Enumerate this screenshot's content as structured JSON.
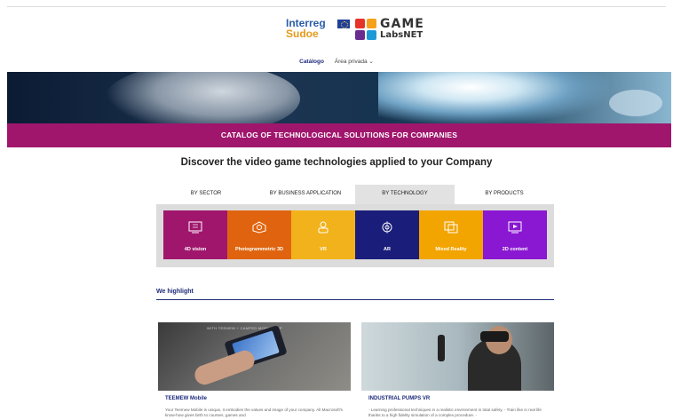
{
  "header": {
    "logo_interreg_line1": "Interreg",
    "logo_interreg_line2": "Sudoe",
    "logo_game_line1": "GAME",
    "logo_game_line2": "LabsNET"
  },
  "nav": {
    "catalog": "Catálogo",
    "private_area": "Área privada ⌄"
  },
  "banner": {
    "text": "CATALOG OF TECHNOLOGICAL SOLUTIONS FOR COMPANIES"
  },
  "heading": "Discover the video game technologies applied to your Company",
  "tabs": [
    {
      "label": "BY SECTOR",
      "active": false
    },
    {
      "label": "BY BUSINESS APPLICATION",
      "active": false
    },
    {
      "label": "BY TECHNOLOGY",
      "active": true
    },
    {
      "label": "BY PRODUCTS",
      "active": false
    }
  ],
  "tiles": [
    {
      "label": "4D vision",
      "color": "#a0166d",
      "icon": "4d-vision-icon"
    },
    {
      "label": "Photogrammetric 3D",
      "color": "#e0640f",
      "icon": "photogrammetry-icon"
    },
    {
      "label": "VR",
      "color": "#f2b21b",
      "icon": "vr-headset-icon"
    },
    {
      "label": "AR",
      "color": "#1a1d7a",
      "icon": "ar-icon"
    },
    {
      "label": "Mixed Reality",
      "color": "#f2a400",
      "icon": "mixed-reality-icon"
    },
    {
      "label": "2D content",
      "color": "#8a17d1",
      "icon": "2d-content-icon"
    }
  ],
  "highlight": {
    "title": "We highlight",
    "cards": [
      {
        "image_caption": "WITH TEEMEW + CAMPED MOBILE APP",
        "title": "TEEMEW Mobile",
        "description": "Your Teemew Mobile is unique, it embodies the values and image of your company. All Macrosoft's know-how gives birth to courses, games and"
      },
      {
        "title": "INDUSTRIAL PUMPS VR",
        "description": "- Learning professional techniques in a realistic environment in total safety. - Train like in real life thanks to a high fidelity simulation of a complex procedure. -"
      }
    ]
  }
}
